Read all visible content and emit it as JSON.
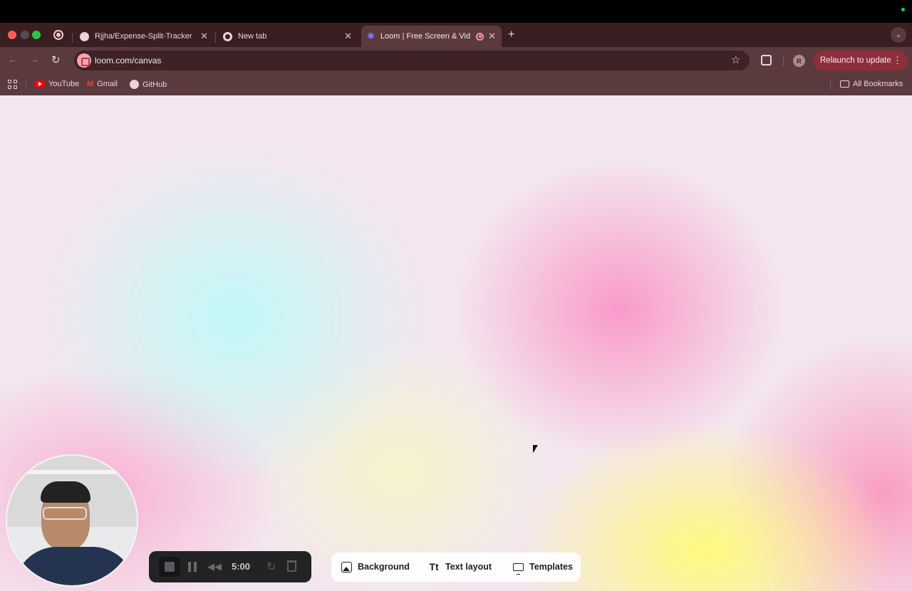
{
  "browser": {
    "tabs": [
      {
        "title": "Rjjha/Expense-Split-Tracker",
        "icon": "github-icon"
      },
      {
        "title": "New tab",
        "icon": "chrome-icon"
      },
      {
        "title": "Loom | Free Screen & Vid",
        "icon": "loom-icon",
        "active": true
      }
    ],
    "new_tab_label": "+",
    "address": "loom.com/canvas",
    "profile_initial": "R",
    "relaunch_label": "Relaunch to update",
    "bookmarks": [
      {
        "label": "YouTube",
        "icon": "youtube-icon"
      },
      {
        "label": "Gmail",
        "icon": "gmail-icon"
      },
      {
        "label": "GitHub",
        "icon": "github-icon"
      }
    ],
    "all_bookmarks_label": "All Bookmarks",
    "colors": {
      "frame": "#3a1f22",
      "toolbar": "#5b3a3e",
      "relaunch": "#8c2f3b"
    }
  },
  "recorder": {
    "timer": "5:00",
    "tools": [
      {
        "label": "Background",
        "icon": "image-icon"
      },
      {
        "label": "Text layout",
        "icon": "text-layout-icon"
      },
      {
        "label": "Templates",
        "icon": "monitor-icon"
      }
    ]
  }
}
